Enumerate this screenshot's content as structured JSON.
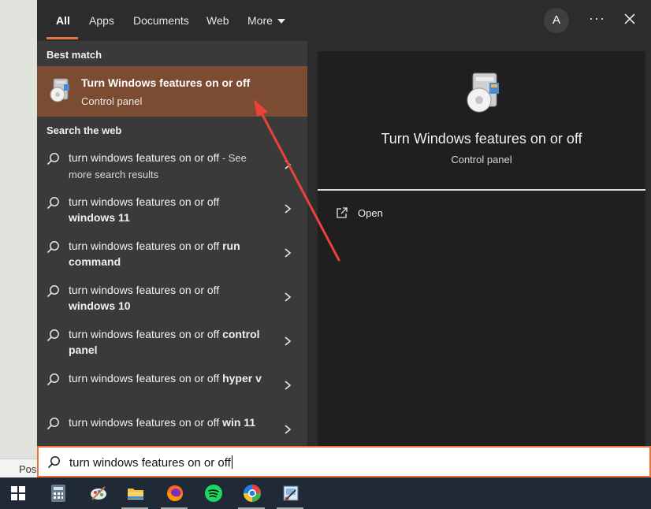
{
  "background": {
    "status_fragment": "Pos"
  },
  "tabs": [
    {
      "label": "All",
      "active": true
    },
    {
      "label": "Apps"
    },
    {
      "label": "Documents"
    },
    {
      "label": "Web"
    },
    {
      "label": "More"
    }
  ],
  "header": {
    "avatar_initial": "A",
    "more_options": "···"
  },
  "best_match": {
    "section": "Best match",
    "title": "Turn Windows features on or off",
    "subtitle": "Control panel"
  },
  "web": {
    "section": "Search the web",
    "items": [
      {
        "prefix": "turn windows features on or off",
        "suffix": "",
        "extra": " - See more search results"
      },
      {
        "prefix": "turn windows features on or off ",
        "suffix": "windows 11"
      },
      {
        "prefix": "turn windows features on or off ",
        "suffix": "run command"
      },
      {
        "prefix": "turn windows features on or off ",
        "suffix": "windows 10"
      },
      {
        "prefix": "turn windows features on or off ",
        "suffix": "control panel"
      },
      {
        "prefix": "turn windows features on or off ",
        "suffix": "hyper v"
      },
      {
        "prefix": "turn windows features on or off ",
        "suffix": "win 11"
      }
    ]
  },
  "detail": {
    "title": "Turn Windows features on or off",
    "subtitle": "Control panel",
    "actions": [
      {
        "label": "Open"
      }
    ]
  },
  "search": {
    "value": "turn windows features on or off"
  },
  "taskbar": {
    "apps": [
      "calculator-icon",
      "paint-icon",
      "file-explorer-icon",
      "firefox-icon",
      "spotify-icon",
      "edge-icon",
      "snipping-tool-icon"
    ]
  },
  "colors": {
    "accent": "#e8743c",
    "selection": "#7b4b32",
    "arrow": "#e8423a"
  }
}
